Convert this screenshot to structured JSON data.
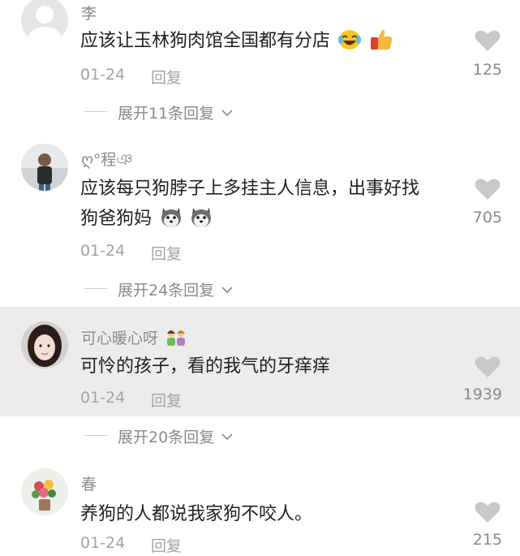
{
  "comments": [
    {
      "username": "李",
      "text": "应该让玉林狗肉馆全国都有分店",
      "emojis": [
        "laughing-crying-emoji",
        "thumbs-up-emoji"
      ],
      "date": "01-24",
      "reply_label": "回复",
      "likes": "125",
      "expand_label": "展开11条回复"
    },
    {
      "username": "ღ°程ঞ",
      "text_line1": "应该每只狗脖子上多挂主人信息，出事好找",
      "text_line2": "狗爸狗妈",
      "emojis": [
        "husky-emoji",
        "husky-emoji"
      ],
      "date": "01-24",
      "reply_label": "回复",
      "likes": "705",
      "expand_label": "展开24条回复"
    },
    {
      "username": "可心暖心呀",
      "username_emoji": "two-people-emoji",
      "text": "可怜的孩子，看的我气的牙痒痒",
      "date": "01-24",
      "reply_label": "回复",
      "likes": "1939",
      "expand_label": "展开20条回复",
      "highlighted": true
    },
    {
      "username": "春",
      "text": "养狗的人都说我家狗不咬人。",
      "date": "01-24",
      "reply_label": "回复",
      "likes": "215"
    }
  ],
  "colors": {
    "highlight_bg": "#ececec",
    "heart": "#c8c8c8",
    "meta_text": "#a3a3a3",
    "body_text": "#1f1f1f"
  }
}
